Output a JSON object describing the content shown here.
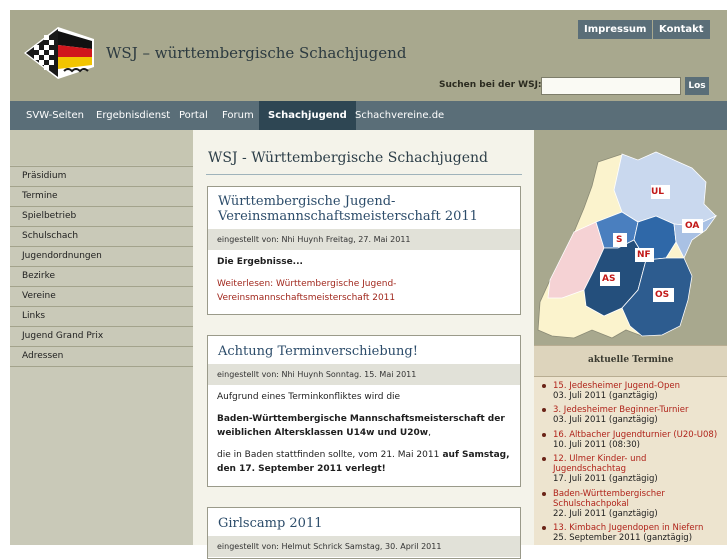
{
  "header": {
    "site_title": "WSJ – württembergische Schachjugend",
    "links": [
      "Impressum",
      "Kontakt"
    ],
    "search_label": "Suchen bei der WSJ:",
    "search_value": "",
    "search_button": "Los"
  },
  "nav": {
    "items": [
      "SVW-Seiten",
      "Ergebnisdienst",
      "Portal",
      "Forum",
      "Schachjugend",
      "Schachvereine.de"
    ],
    "active": "Schachjugend"
  },
  "sidebar": {
    "items": [
      "Präsidium",
      "Termine",
      "Spielbetrieb",
      "Schulschach",
      "Jugendordnungen",
      "Bezirke",
      "Vereine",
      "Links",
      "Jugend Grand Prix",
      "Adressen"
    ]
  },
  "main": {
    "title": "WSJ - Württembergische Schachjugend",
    "posts": [
      {
        "title_line1": "Württembergische Jugend-",
        "title_line2": "Vereinsmannschaftsmeisterschaft 2011",
        "meta": "eingestellt von: Nhi Huynh Freitag, 27. Mai 2011",
        "lead": "Die Ergebnisse...",
        "more_line1": "Weiterlesen: Württembergische Jugend-",
        "more_line2": "Vereinsmannschaftsmeisterschaft 2011"
      },
      {
        "title": "Achtung Terminverschiebung!",
        "meta": "eingestellt von: Nhi Huynh Sonntag. 15. Mai 2011",
        "p1": "Aufgrund eines Terminkonfliktes wird die",
        "p2_line1": "Baden-Württembergische Mannschaftsmeisterschaft der",
        "p2_line2_bold": "weiblichen Altersklassen U14w und U20w",
        "p2_line2_rest": ",",
        "p3_line1": "die in Baden stattfinden sollte, vom 21. Mai 2011",
        "p3_line1_bold": " auf Samstag,",
        "p3_line2_bold": "den 17. September 2011 verlegt!"
      },
      {
        "title": "Girlscamp 2011",
        "meta": "eingestellt von: Helmut Schrick Samstag, 30. April 2011"
      }
    ]
  },
  "map": {
    "regions": [
      "UL",
      "OA",
      "S",
      "NF",
      "AS",
      "OS"
    ],
    "colors": {
      "light": "#c9d8ee",
      "mid": "#4a7fbf",
      "dark": "#2a5a8a",
      "pink": "#f5d2d4",
      "cream": "#fbf3cd"
    }
  },
  "termine": {
    "title": "aktuelle Termine",
    "events": [
      {
        "title": "15. Jedesheimer Jugend-Open",
        "date": "03. Juli 2011 (ganztägig)"
      },
      {
        "title": "3. Jedesheimer Beginner-Turnier",
        "date": "03. Juli 2011 (ganztägig)"
      },
      {
        "title": "16. Altbacher Jugendturnier (U20-U08)",
        "date": "10. Juli 2011 (08:30)"
      },
      {
        "title_line1": "12. Ulmer Kinder- und",
        "title_line2": "Jugendschachtag",
        "date": "17. Juli 2011 (ganztägig)"
      },
      {
        "title_line1": "Baden-Württembergischer",
        "title_line2": "Schulschachpokal",
        "date": "22. Juli 2011 (ganztägig)"
      },
      {
        "title": "13. Kimbach Jugendopen in Niefern",
        "date": "25. September 2011 (ganztägig)"
      }
    ]
  }
}
